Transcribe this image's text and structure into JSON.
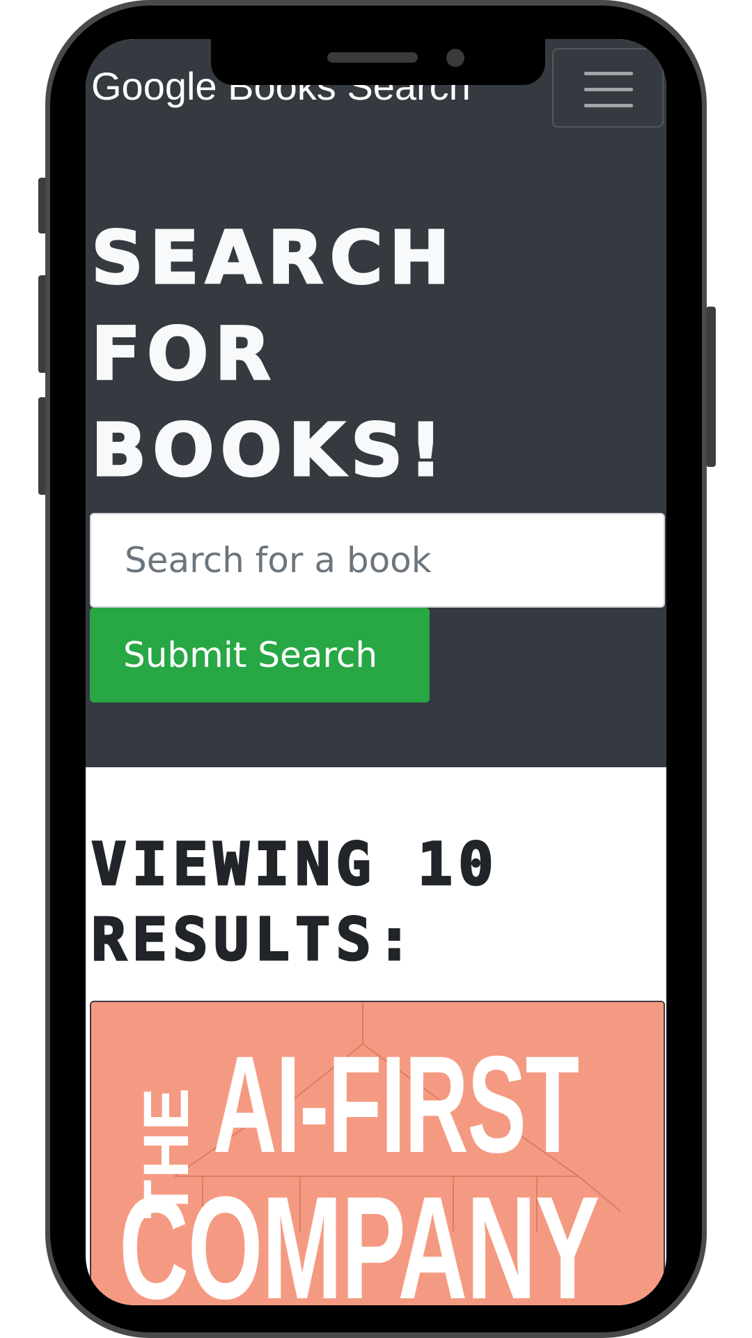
{
  "navbar": {
    "brand": "Google Books Search",
    "menu_icon": "hamburger-menu-icon"
  },
  "hero": {
    "title_lines": [
      "SEARCH",
      "FOR",
      "BOOKS!"
    ]
  },
  "search": {
    "placeholder": "Search for a book",
    "value": "",
    "submit_label": "Submit Search"
  },
  "results": {
    "heading": "VIEWING 10 RESULTS:",
    "items": [
      {
        "cover_lines": [
          "THE",
          "AI-FIRST",
          "COMPANY"
        ]
      }
    ]
  },
  "colors": {
    "navbar_bg": "#343a40",
    "hero_text": "#f8f9fa",
    "submit_bg": "#28a745",
    "heading_text": "#212529",
    "cover_bg": "#f59a82"
  }
}
